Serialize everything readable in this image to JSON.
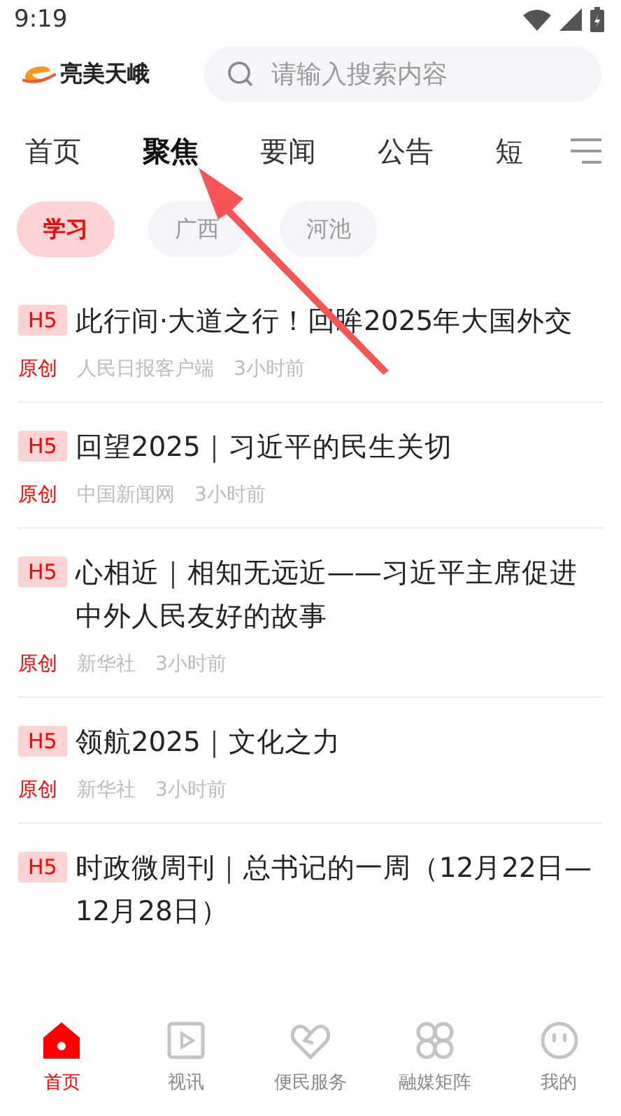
{
  "status_bar": {
    "time": "9:19"
  },
  "header": {
    "logo_text": "亮美天峨",
    "search": {
      "placeholder": "请输入搜索内容"
    }
  },
  "tabs": [
    {
      "label": "首页",
      "selected": false
    },
    {
      "label": "聚焦",
      "selected": true
    },
    {
      "label": "要闻",
      "selected": false
    },
    {
      "label": "公告",
      "selected": false
    },
    {
      "label": "短",
      "selected": false
    }
  ],
  "chips": [
    {
      "label": "学习",
      "selected": true
    },
    {
      "label": "广西",
      "selected": false
    },
    {
      "label": "河池",
      "selected": false
    }
  ],
  "articles": [
    {
      "badge": "H5",
      "title": "此行间·大道之行！回眸2025年大国外交",
      "tag": "原创",
      "source": "人民日报客户端",
      "time": "3小时前"
    },
    {
      "badge": "H5",
      "title": "回望2025｜习近平的民生关切",
      "tag": "原创",
      "source": "中国新闻网",
      "time": "3小时前"
    },
    {
      "badge": "H5",
      "title": "心相近｜相知无远近——习近平主席促进中外人民友好的故事",
      "tag": "原创",
      "source": "新华社",
      "time": "3小时前"
    },
    {
      "badge": "H5",
      "title": "领航2025｜文化之力",
      "tag": "原创",
      "source": "新华社",
      "time": "3小时前"
    },
    {
      "badge": "H5",
      "title": "时政微周刊｜总书记的一周（12月22日—12月28日）"
    }
  ],
  "bottom_nav": [
    {
      "label": "首页",
      "kind": "home",
      "selected": true
    },
    {
      "label": "视讯",
      "kind": "video",
      "selected": false
    },
    {
      "label": "便民服务",
      "kind": "service",
      "selected": false
    },
    {
      "label": "融媒矩阵",
      "kind": "matrix",
      "selected": false
    },
    {
      "label": "我的",
      "kind": "profile",
      "selected": false
    }
  ]
}
